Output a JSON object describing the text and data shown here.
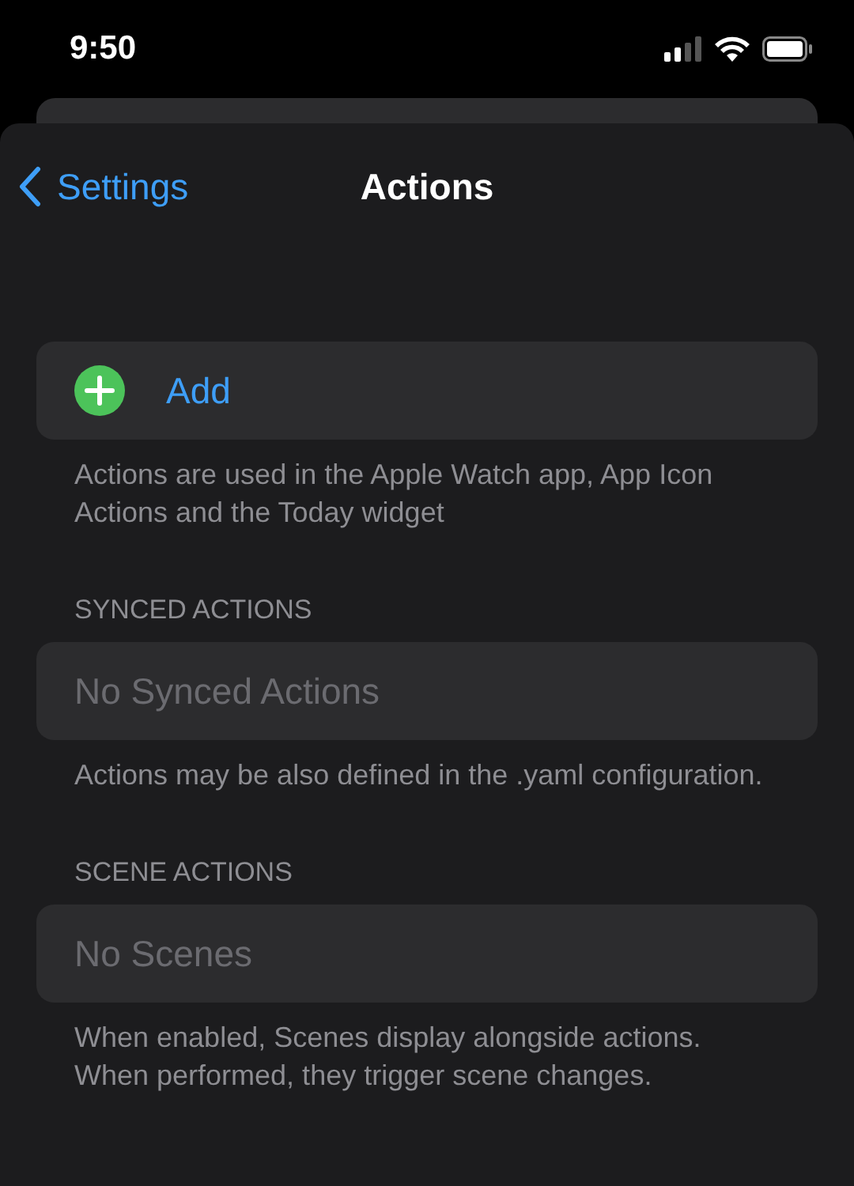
{
  "status_bar": {
    "time": "9:50"
  },
  "nav": {
    "back": "Settings",
    "title": "Actions"
  },
  "sections": [
    {
      "row": {
        "kind": "add",
        "label": "Add"
      },
      "footer": "Actions are used in the Apple Watch app, App Icon Actions and the Today widget"
    },
    {
      "header": "SYNCED ACTIONS",
      "row": {
        "kind": "empty",
        "label": "No Synced Actions"
      },
      "footer": "Actions may be also defined in the .yaml configuration."
    },
    {
      "header": "SCENE ACTIONS",
      "row": {
        "kind": "empty",
        "label": "No Scenes"
      },
      "footer": "When enabled, Scenes display alongside actions. When performed, they trigger scene changes."
    }
  ]
}
